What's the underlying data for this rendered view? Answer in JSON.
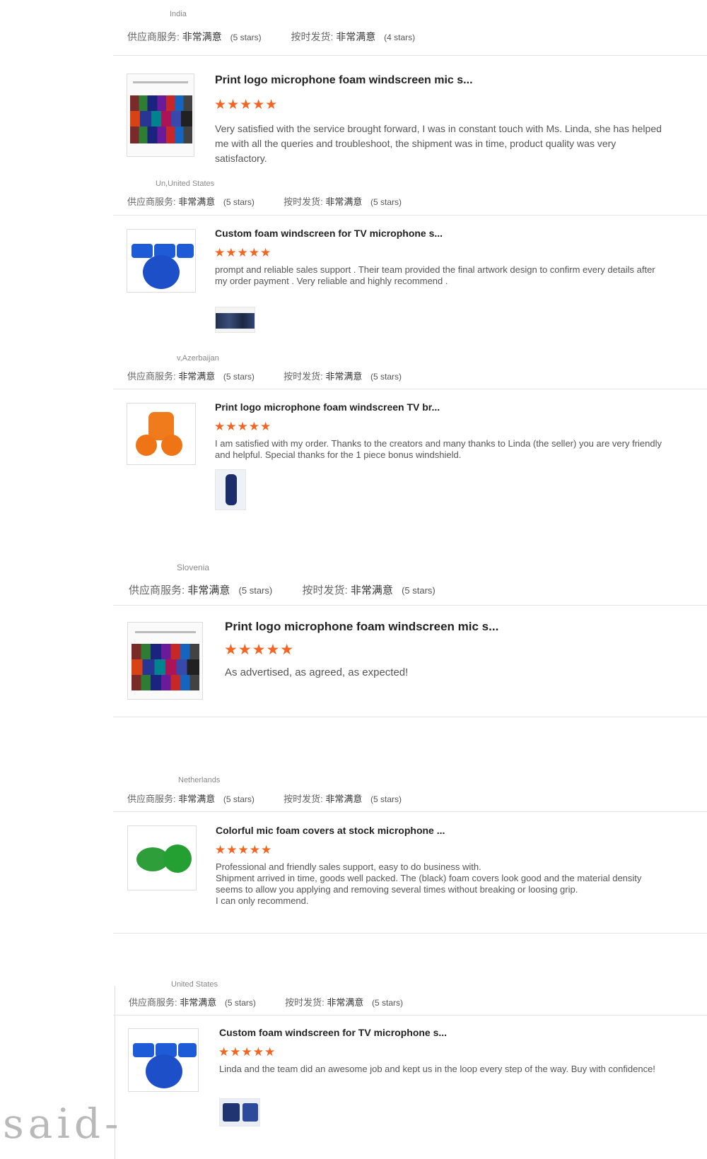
{
  "rating_labels": {
    "service": "供应商服务:",
    "shipping": "按时发货:",
    "value": "非常满意"
  },
  "reviews": [
    {
      "location": "India",
      "service_stars": "(5 stars)",
      "shipping_stars": "(4 stars)",
      "product_title": "Print logo microphone foam windscreen mic s...",
      "stars": "★★★★★",
      "text": "Very satisfied with the service brought forward, I was in constant touch with Ms. Linda, she has helped me with all the queries and troubleshoot, the shipment was in time, product quality was very satisfactory."
    },
    {
      "location": "Un,United States",
      "service_stars": "(5 stars)",
      "shipping_stars": "(5 stars)",
      "product_title": "Custom foam windscreen for TV microphone s...",
      "stars": "★★★★★",
      "text": "prompt and reliable sales support . Their team provided the final artwork design to confirm every details after my order payment . Very reliable and highly recommend ."
    },
    {
      "location": "v,Azerbaijan",
      "service_stars": "(5 stars)",
      "shipping_stars": "(5 stars)",
      "product_title": "Print logo microphone foam windscreen TV br...",
      "stars": "★★★★★",
      "text": "I am satisfied with my order. Thanks to the creators and many thanks to Linda (the seller) you are very friendly and helpful. Special thanks for the 1 piece bonus windshield."
    },
    {
      "location": "Slovenia",
      "service_stars": "(5 stars)",
      "shipping_stars": "(5 stars)",
      "product_title": "Print logo microphone foam windscreen mic s...",
      "stars": "★★★★★",
      "text": "As advertised, as agreed, as expected!"
    },
    {
      "location": "Netherlands",
      "service_stars": "(5 stars)",
      "shipping_stars": "(5 stars)",
      "product_title": "Colorful mic foam covers at stock microphone ...",
      "stars": "★★★★★",
      "text": "Professional and friendly sales support, easy to do business with.\nShipment arrived in time, goods well packed. The (black) foam covers look good and the material density seems to allow you applying and removing several times without breaking or loosing grip.\nI can only recommend."
    },
    {
      "location": "United States",
      "service_stars": "(5 stars)",
      "shipping_stars": "(5 stars)",
      "product_title": "Custom foam windscreen for TV microphone s...",
      "stars": "★★★★★",
      "text": "Linda and the team did an awesome job and kept us in the loop every step of the way. Buy with confidence!"
    }
  ],
  "watermark": "said-",
  "colors": {
    "star": "#f26522",
    "divider": "#e4e4e4"
  }
}
